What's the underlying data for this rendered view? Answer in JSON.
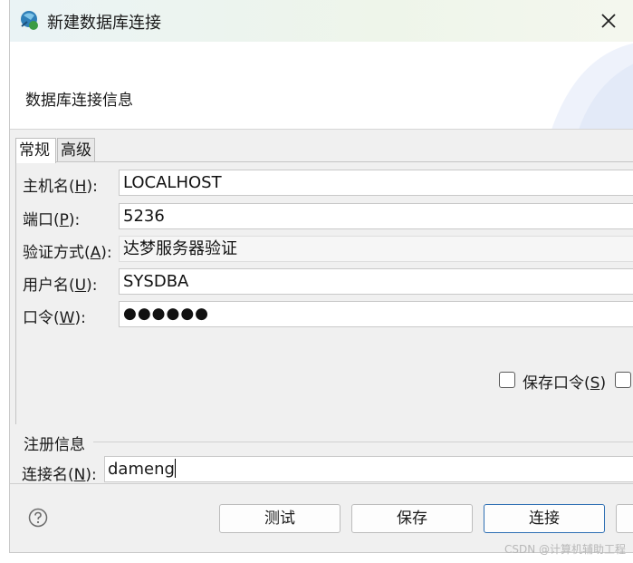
{
  "window": {
    "title": "新建数据库连接",
    "close_icon": "close-icon",
    "app_icon": "db-connection-icon"
  },
  "banner": {
    "title": "数据库连接信息"
  },
  "tabs": [
    {
      "label": "常规",
      "active": true
    },
    {
      "label": "高级",
      "active": false
    }
  ],
  "fields": {
    "host": {
      "label_pre": "主机名(",
      "mnemonic": "H",
      "label_post": "):",
      "value": "LOCALHOST"
    },
    "port": {
      "label_pre": "端口(",
      "mnemonic": "P",
      "label_post": "):",
      "value": "5236"
    },
    "auth": {
      "label_pre": "验证方式(",
      "mnemonic": "A",
      "label_post": "):",
      "value": "达梦服务器验证"
    },
    "user": {
      "label_pre": "用户名(",
      "mnemonic": "U",
      "label_post": "):",
      "value": "SYSDBA"
    },
    "password": {
      "label_pre": "口令(",
      "mnemonic": "W",
      "label_post": "):",
      "value": "●●●●●●"
    }
  },
  "save_password": {
    "label_pre": "保存口令(",
    "mnemonic": "S",
    "label_post": ")",
    "checked": false
  },
  "registration": {
    "section_title": "注册信息",
    "conn_name": {
      "label_pre": "连接名(",
      "mnemonic": "N",
      "label_post": "):",
      "value": "dameng"
    }
  },
  "buttons": {
    "test": "测试",
    "save": "保存",
    "connect": "连接"
  },
  "icons": {
    "help": "help-icon"
  },
  "watermark": "CSDN @计算机辅助工程",
  "colors": {
    "accent_border": "#2e6fb3",
    "banner_bg": "#ffffff",
    "window_bg": "#f0f0f0"
  }
}
